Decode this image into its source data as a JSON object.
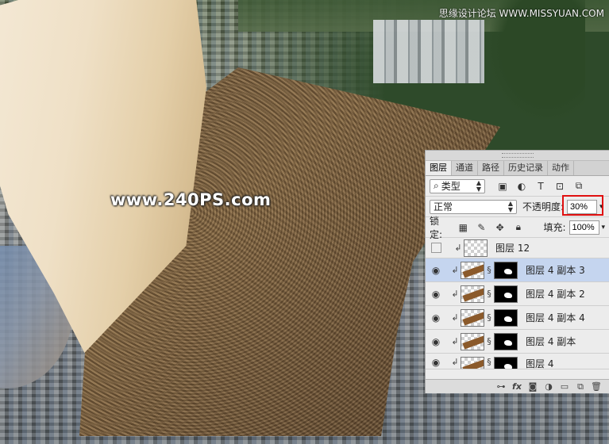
{
  "watermark": "www.240PS.com",
  "top_watermark": "思缘设计论坛  WWW.MISSYUAN.COM",
  "panel": {
    "tabs": [
      "图层",
      "通道",
      "路径",
      "历史记录",
      "动作"
    ],
    "filter": {
      "label": "类型",
      "icons": [
        "image-icon",
        "adjustment-icon",
        "type-icon",
        "shape-icon",
        "smart-object-icon"
      ]
    },
    "blend_mode": "正常",
    "opacity_label": "不透明度:",
    "opacity_value": "30%",
    "lock_label": "锁定:",
    "fill_label": "填充:",
    "fill_value": "100%",
    "layers": [
      {
        "name": "图层 12",
        "visible": false,
        "mask": false,
        "selected": false
      },
      {
        "name": "图层 4 副本 3",
        "visible": true,
        "mask": true,
        "selected": true
      },
      {
        "name": "图层 4 副本 2",
        "visible": true,
        "mask": true,
        "selected": false
      },
      {
        "name": "图层 4 副本 4",
        "visible": true,
        "mask": true,
        "selected": false
      },
      {
        "name": "图层 4 副本",
        "visible": true,
        "mask": true,
        "selected": false
      },
      {
        "name": "图层 4",
        "visible": true,
        "mask": true,
        "selected": false
      }
    ],
    "footer_icons": [
      "link-icon",
      "fx-icon",
      "mask-icon",
      "adjustment-layer-icon",
      "group-icon",
      "new-layer-icon",
      "trash-icon"
    ],
    "colors": {
      "selected_row": "#c5d5ef",
      "highlight_box": "#e01010"
    }
  }
}
